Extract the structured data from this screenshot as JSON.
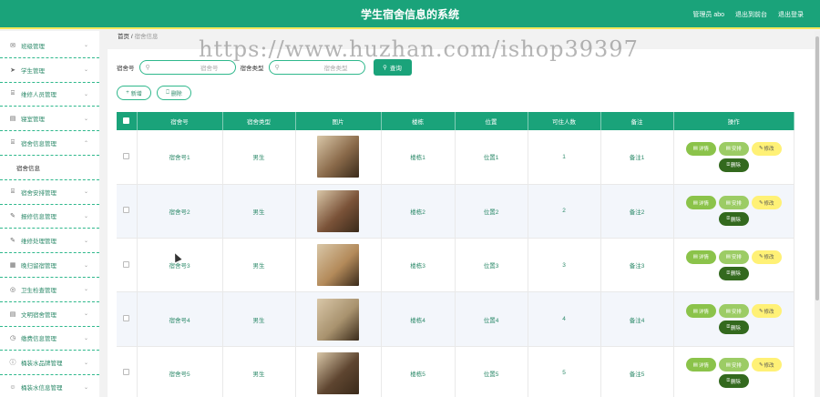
{
  "header": {
    "title": "学生宿舍信息的系统",
    "admin": "管理员 abo",
    "back_label": "退出到前台",
    "logout_label": "退出登录"
  },
  "sidebar": {
    "items": [
      {
        "label": "班级管理",
        "icon": "mail-icon"
      },
      {
        "label": "学生管理",
        "icon": "send-icon"
      },
      {
        "label": "维修人员管理",
        "icon": "trash-icon"
      },
      {
        "label": "寝室管理",
        "icon": "card-icon"
      },
      {
        "label": "宿舍信息管理",
        "icon": "trash-icon",
        "expanded": true
      },
      {
        "label": "宿舍信息",
        "sub": true
      },
      {
        "label": "宿舍安排管理",
        "icon": "trash-icon"
      },
      {
        "label": "报修信息管理",
        "icon": "edit-icon"
      },
      {
        "label": "维修处理管理",
        "icon": "edit-icon"
      },
      {
        "label": "晚归留宿管理",
        "icon": "grid-icon"
      },
      {
        "label": "卫生检查管理",
        "icon": "circle-icon"
      },
      {
        "label": "文明宿舍管理",
        "icon": "card-icon"
      },
      {
        "label": "缴费信息管理",
        "icon": "clock-icon"
      },
      {
        "label": "桶装水品牌管理",
        "icon": "info-icon"
      },
      {
        "label": "桶装水信息管理",
        "icon": "user-icon"
      }
    ]
  },
  "breadcrumb": {
    "home": "首页",
    "sep": "/",
    "current": "宿舍信息"
  },
  "search": {
    "dorm_no_label": "宿舍号",
    "dorm_no_placeholder": "宿舍号",
    "dorm_type_label": "宿舍类型",
    "dorm_type_placeholder": "宿舍类型",
    "query_label": "查询"
  },
  "actions": {
    "add_label": "新增",
    "delete_label": "删除"
  },
  "table": {
    "headers": [
      "宿舍号",
      "宿舍类型",
      "图片",
      "楼栋",
      "位置",
      "可住人数",
      "备注",
      "操作"
    ],
    "rows": [
      {
        "dorm_no": "宿舍号1",
        "type": "男生",
        "building": "楼栋1",
        "location": "位置1",
        "capacity": "1",
        "remark": "备注1",
        "img": "#8a6a4a"
      },
      {
        "dorm_no": "宿舍号2",
        "type": "男生",
        "building": "楼栋2",
        "location": "位置2",
        "capacity": "2",
        "remark": "备注2",
        "img": "#7a5238"
      },
      {
        "dorm_no": "宿舍号3",
        "type": "男生",
        "building": "楼栋3",
        "location": "位置3",
        "capacity": "3",
        "remark": "备注3",
        "img": "#b38a5a"
      },
      {
        "dorm_no": "宿舍号4",
        "type": "男生",
        "building": "楼栋4",
        "location": "位置4",
        "capacity": "4",
        "remark": "备注4",
        "img": "#a8926e"
      },
      {
        "dorm_no": "宿舍号5",
        "type": "男生",
        "building": "楼栋5",
        "location": "位置5",
        "capacity": "5",
        "remark": "备注5",
        "img": "#5e4530"
      }
    ],
    "op_labels": {
      "detail": "详情",
      "arrange": "安排",
      "edit": "修改",
      "delete": "删除"
    }
  },
  "watermark": "https://www.huzhan.com/ishop39397",
  "colors": {
    "primary": "#1aa37a",
    "accent_yellow": "#f5e85a",
    "dark_green": "#33691e"
  }
}
